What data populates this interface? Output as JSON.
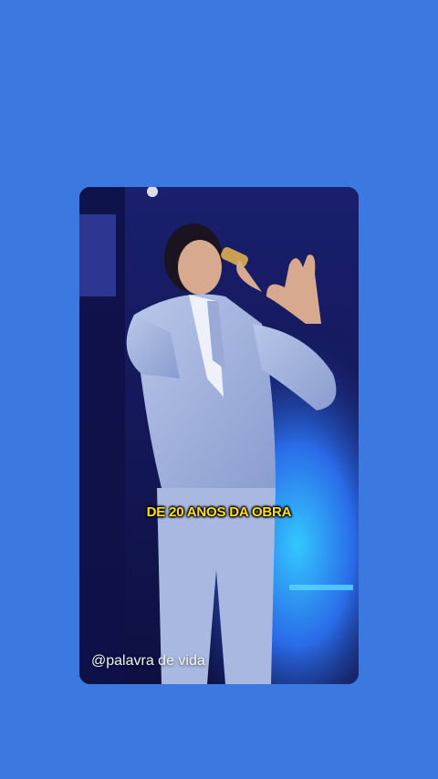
{
  "colors": {
    "page_background": "#3b78e0",
    "subtitle_text": "#ffe01b",
    "watermark_text": "#f2f2f2"
  },
  "video": {
    "subtitle": "DE 20 ANOS DA OBRA",
    "watermark": "@palavra de vida"
  }
}
